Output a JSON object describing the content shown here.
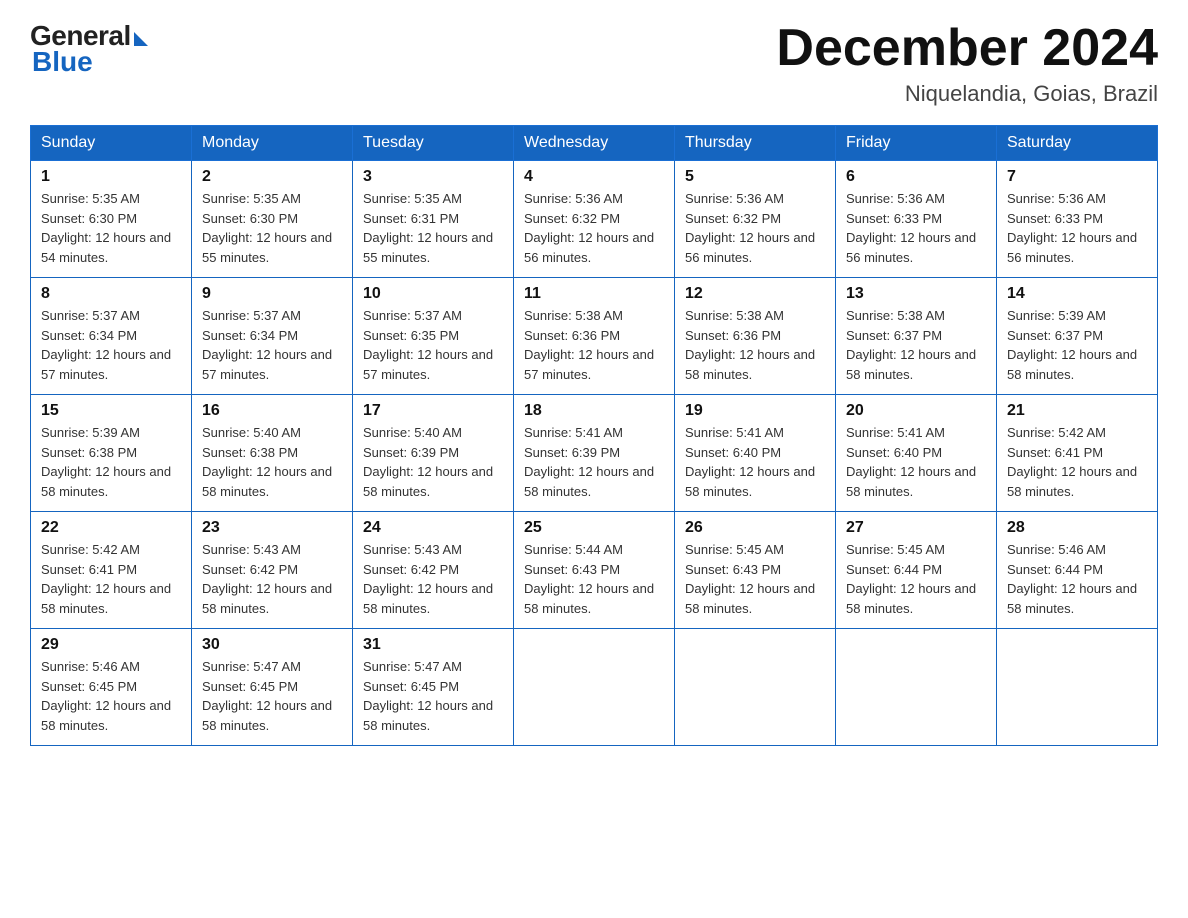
{
  "logo": {
    "general_text": "General",
    "blue_text": "Blue"
  },
  "header": {
    "month_year": "December 2024",
    "location": "Niquelandia, Goias, Brazil"
  },
  "weekdays": [
    "Sunday",
    "Monday",
    "Tuesday",
    "Wednesday",
    "Thursday",
    "Friday",
    "Saturday"
  ],
  "weeks": [
    [
      {
        "day": "1",
        "sunrise": "5:35 AM",
        "sunset": "6:30 PM",
        "daylight": "12 hours and 54 minutes."
      },
      {
        "day": "2",
        "sunrise": "5:35 AM",
        "sunset": "6:30 PM",
        "daylight": "12 hours and 55 minutes."
      },
      {
        "day": "3",
        "sunrise": "5:35 AM",
        "sunset": "6:31 PM",
        "daylight": "12 hours and 55 minutes."
      },
      {
        "day": "4",
        "sunrise": "5:36 AM",
        "sunset": "6:32 PM",
        "daylight": "12 hours and 56 minutes."
      },
      {
        "day": "5",
        "sunrise": "5:36 AM",
        "sunset": "6:32 PM",
        "daylight": "12 hours and 56 minutes."
      },
      {
        "day": "6",
        "sunrise": "5:36 AM",
        "sunset": "6:33 PM",
        "daylight": "12 hours and 56 minutes."
      },
      {
        "day": "7",
        "sunrise": "5:36 AM",
        "sunset": "6:33 PM",
        "daylight": "12 hours and 56 minutes."
      }
    ],
    [
      {
        "day": "8",
        "sunrise": "5:37 AM",
        "sunset": "6:34 PM",
        "daylight": "12 hours and 57 minutes."
      },
      {
        "day": "9",
        "sunrise": "5:37 AM",
        "sunset": "6:34 PM",
        "daylight": "12 hours and 57 minutes."
      },
      {
        "day": "10",
        "sunrise": "5:37 AM",
        "sunset": "6:35 PM",
        "daylight": "12 hours and 57 minutes."
      },
      {
        "day": "11",
        "sunrise": "5:38 AM",
        "sunset": "6:36 PM",
        "daylight": "12 hours and 57 minutes."
      },
      {
        "day": "12",
        "sunrise": "5:38 AM",
        "sunset": "6:36 PM",
        "daylight": "12 hours and 58 minutes."
      },
      {
        "day": "13",
        "sunrise": "5:38 AM",
        "sunset": "6:37 PM",
        "daylight": "12 hours and 58 minutes."
      },
      {
        "day": "14",
        "sunrise": "5:39 AM",
        "sunset": "6:37 PM",
        "daylight": "12 hours and 58 minutes."
      }
    ],
    [
      {
        "day": "15",
        "sunrise": "5:39 AM",
        "sunset": "6:38 PM",
        "daylight": "12 hours and 58 minutes."
      },
      {
        "day": "16",
        "sunrise": "5:40 AM",
        "sunset": "6:38 PM",
        "daylight": "12 hours and 58 minutes."
      },
      {
        "day": "17",
        "sunrise": "5:40 AM",
        "sunset": "6:39 PM",
        "daylight": "12 hours and 58 minutes."
      },
      {
        "day": "18",
        "sunrise": "5:41 AM",
        "sunset": "6:39 PM",
        "daylight": "12 hours and 58 minutes."
      },
      {
        "day": "19",
        "sunrise": "5:41 AM",
        "sunset": "6:40 PM",
        "daylight": "12 hours and 58 minutes."
      },
      {
        "day": "20",
        "sunrise": "5:41 AM",
        "sunset": "6:40 PM",
        "daylight": "12 hours and 58 minutes."
      },
      {
        "day": "21",
        "sunrise": "5:42 AM",
        "sunset": "6:41 PM",
        "daylight": "12 hours and 58 minutes."
      }
    ],
    [
      {
        "day": "22",
        "sunrise": "5:42 AM",
        "sunset": "6:41 PM",
        "daylight": "12 hours and 58 minutes."
      },
      {
        "day": "23",
        "sunrise": "5:43 AM",
        "sunset": "6:42 PM",
        "daylight": "12 hours and 58 minutes."
      },
      {
        "day": "24",
        "sunrise": "5:43 AM",
        "sunset": "6:42 PM",
        "daylight": "12 hours and 58 minutes."
      },
      {
        "day": "25",
        "sunrise": "5:44 AM",
        "sunset": "6:43 PM",
        "daylight": "12 hours and 58 minutes."
      },
      {
        "day": "26",
        "sunrise": "5:45 AM",
        "sunset": "6:43 PM",
        "daylight": "12 hours and 58 minutes."
      },
      {
        "day": "27",
        "sunrise": "5:45 AM",
        "sunset": "6:44 PM",
        "daylight": "12 hours and 58 minutes."
      },
      {
        "day": "28",
        "sunrise": "5:46 AM",
        "sunset": "6:44 PM",
        "daylight": "12 hours and 58 minutes."
      }
    ],
    [
      {
        "day": "29",
        "sunrise": "5:46 AM",
        "sunset": "6:45 PM",
        "daylight": "12 hours and 58 minutes."
      },
      {
        "day": "30",
        "sunrise": "5:47 AM",
        "sunset": "6:45 PM",
        "daylight": "12 hours and 58 minutes."
      },
      {
        "day": "31",
        "sunrise": "5:47 AM",
        "sunset": "6:45 PM",
        "daylight": "12 hours and 58 minutes."
      },
      null,
      null,
      null,
      null
    ]
  ]
}
